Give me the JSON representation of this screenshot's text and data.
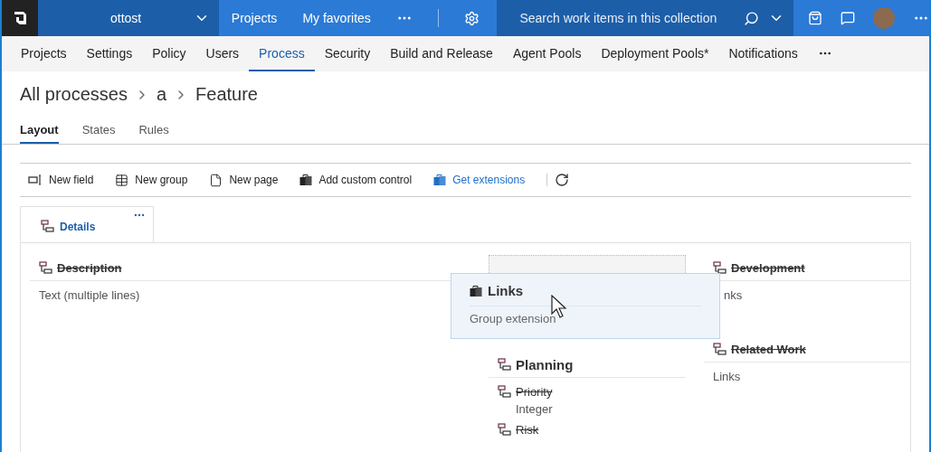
{
  "topbar": {
    "account": "ottost",
    "links": [
      {
        "label": "Projects"
      },
      {
        "label": "My favorites"
      }
    ],
    "search": {
      "placeholder": "Search work items in this collection"
    }
  },
  "admin_tabs": [
    {
      "label": "Projects",
      "selected": false
    },
    {
      "label": "Settings",
      "selected": false
    },
    {
      "label": "Policy",
      "selected": false
    },
    {
      "label": "Users",
      "selected": false
    },
    {
      "label": "Process",
      "selected": true
    },
    {
      "label": "Security",
      "selected": false
    },
    {
      "label": "Build and Release",
      "selected": false
    },
    {
      "label": "Agent Pools",
      "selected": false
    },
    {
      "label": "Deployment Pools*",
      "selected": false
    },
    {
      "label": "Notifications",
      "selected": false
    }
  ],
  "breadcrumb": [
    "All processes",
    "a",
    "Feature"
  ],
  "view_tabs": [
    {
      "label": "Layout",
      "selected": true
    },
    {
      "label": "States",
      "selected": false
    },
    {
      "label": "Rules",
      "selected": false
    }
  ],
  "toolbar": [
    {
      "label": "New field",
      "kind": "field"
    },
    {
      "label": "New group",
      "kind": "group"
    },
    {
      "label": "New page",
      "kind": "page"
    },
    {
      "label": "Add custom control",
      "kind": "control"
    },
    {
      "label": "Get extensions",
      "kind": "extensions"
    }
  ],
  "page_tabs": [
    {
      "label": "Details",
      "selected": true
    }
  ],
  "columns": [
    [
      {
        "kind": "group",
        "title": "Description",
        "hidden": true,
        "subtitle": "Text (multiple lines)"
      }
    ],
    [
      {
        "kind": "placeholder"
      },
      {
        "kind": "group",
        "title": "Planning",
        "hidden": false,
        "fields": [
          {
            "label": "Priority",
            "hidden": true,
            "type": "Integer"
          },
          {
            "label": "Risk",
            "hidden": true
          }
        ]
      }
    ],
    [
      {
        "kind": "group",
        "title": "Development",
        "hidden": true,
        "subtitle": "nks",
        "covered": true
      },
      {
        "kind": "group",
        "title": "Related Work",
        "hidden": true,
        "subtitle": "Links"
      }
    ]
  ],
  "drag_card": {
    "title": "Links",
    "subtitle": "Group extension"
  }
}
